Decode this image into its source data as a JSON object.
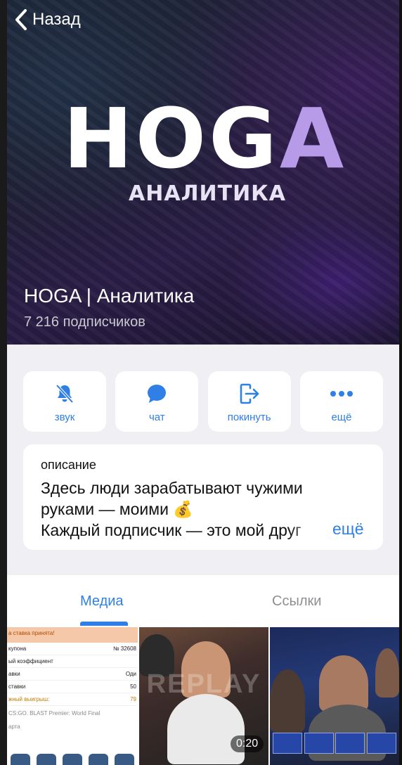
{
  "nav": {
    "back_label": "Назад"
  },
  "hero": {
    "logo_main": "HOG",
    "logo_accent": "A",
    "logo_sub": "АНАЛИТИКА",
    "channel_name": "HOGA | Аналитика",
    "subscribers": "7 216 подписчиков"
  },
  "actions": [
    {
      "label": "звук",
      "icon": "bell-slash-icon"
    },
    {
      "label": "чат",
      "icon": "chat-bubble-icon"
    },
    {
      "label": "покинуть",
      "icon": "leave-icon"
    },
    {
      "label": "ещё",
      "icon": "more-dots-icon"
    }
  ],
  "description": {
    "title": "описание",
    "line1": "Здесь люди зарабатывают чужими",
    "line2": "руками — моими 💰",
    "line3": "Каждый подписчик — это мой друг",
    "more": "ещё"
  },
  "tabs": {
    "media": "Медиа",
    "links": "Ссылки",
    "active": "media"
  },
  "media": {
    "ticket": {
      "header": "а ставка принята!",
      "rows": [
        {
          "label": "купона",
          "value": "№ 32608"
        },
        {
          "label": "ый коэффициент",
          "value": ""
        },
        {
          "label": "авки",
          "value": "Оди"
        },
        {
          "label": "ставки",
          "value": "50"
        },
        {
          "label": "жный выигрыш:",
          "value": "79"
        }
      ],
      "footer_event": "CS:GO. BLAST Premier: World Final",
      "footer_extra": "арта"
    },
    "video_duration": "0:20",
    "video_watermark": "REPLAY",
    "accent": "#2f7fe6"
  }
}
